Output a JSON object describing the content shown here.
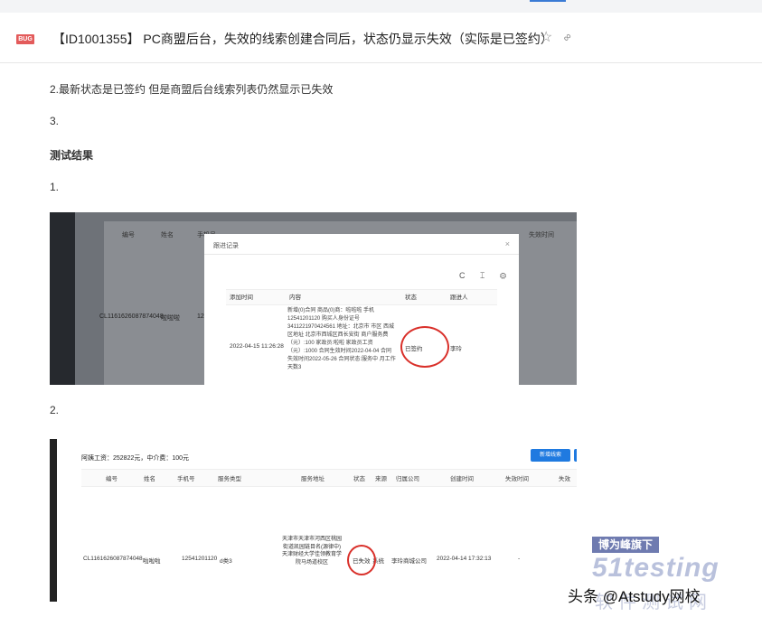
{
  "header": {
    "tag": "BUG",
    "title": "【ID1001355】 PC商盟后台，失效的线索创建合同后，状态仍显示失效（实际是已签约）"
  },
  "content": {
    "line1": "2.最新状态是已签约    但是商盟后台线索列表仍然显示已失效",
    "line2": "3.",
    "section_title": "测试结果",
    "item1": "1.",
    "item2": "2."
  },
  "screenshot1": {
    "headers": [
      "编号",
      "姓名",
      "手机号"
    ],
    "row": {
      "id": "CL1161626087874048",
      "name": "啦啦啦",
      "phone": "12"
    },
    "right_header": "失效时间",
    "dialog": {
      "title": "跟进记录",
      "close": "×",
      "icons": "C ⌶ ⚙",
      "columns": [
        "添加时间",
        "内容",
        "状态",
        "跟进人"
      ],
      "time": "2022-04-15 11:26:28",
      "content": "新增(0)合同 商品(0)商：啦啦啦 手机12541201120 购买人身份证号3411221970424561 地址：北京市 市区 西城区地址 北京市西城区西长安街 商户服务费（元）:100 家政员:啦啦 家政员工资（元）:1000 合同生效时间2022-04-04 合同失效时间2022-05-26 合同状态:服务中 月工作天数3",
      "status": "已签约",
      "follower": "李玲"
    }
  },
  "screenshot2": {
    "summary": "阿姨工资：252822元，中介费：100元",
    "button": "新增线索",
    "headers": [
      "编号",
      "姓名",
      "手机号",
      "服务类型",
      "服务地址",
      "状态",
      "来源",
      "归属公司",
      "创建时间",
      "失效时间",
      "失效"
    ],
    "row": {
      "id": "CL1161626087874048",
      "name": "啦啦啦",
      "phone": "12541201120",
      "type": "d类3",
      "address": "天津市天津市河西区桃园街道凯园链目名(源律中)天津财经大学佳领教育学院马场道校区",
      "status": "已失效",
      "source": "系统",
      "company": "李玲商城公司",
      "created": "2022-04-14 17:32:13",
      "expire": "-"
    }
  },
  "watermark": {
    "badge": "博为峰旗下",
    "brand": "51testing",
    "sub": "软件测试网",
    "credit": "头条 @Atstudy网校"
  }
}
